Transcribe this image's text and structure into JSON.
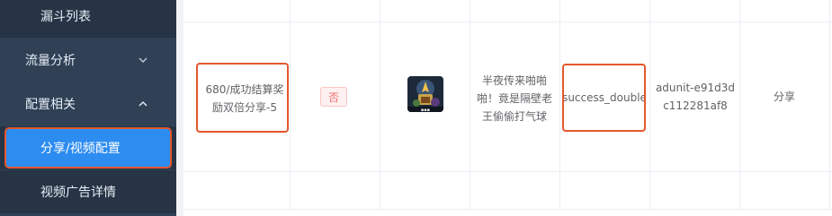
{
  "sidebar": {
    "items": [
      {
        "label": "漏斗列表"
      },
      {
        "label": "流量分析"
      },
      {
        "label": "配置相关"
      },
      {
        "label": "分享/视频配置"
      },
      {
        "label": "视频广告详情"
      }
    ],
    "colors": {
      "background": "#304156",
      "submenu": "#263445",
      "active": "#2d8cf0",
      "highlight": "#e4572e"
    }
  },
  "table": {
    "row": {
      "name": "680/成功结算奖励双倍分享-5",
      "flag": "否",
      "image_icon": "game-thumbnail",
      "title": "半夜传来啪啪啪！竟是隔壁老王偷偷打气球",
      "key": "success_double",
      "ad_unit": "adunit-e91d3dc112281af8",
      "type": "分享"
    }
  }
}
